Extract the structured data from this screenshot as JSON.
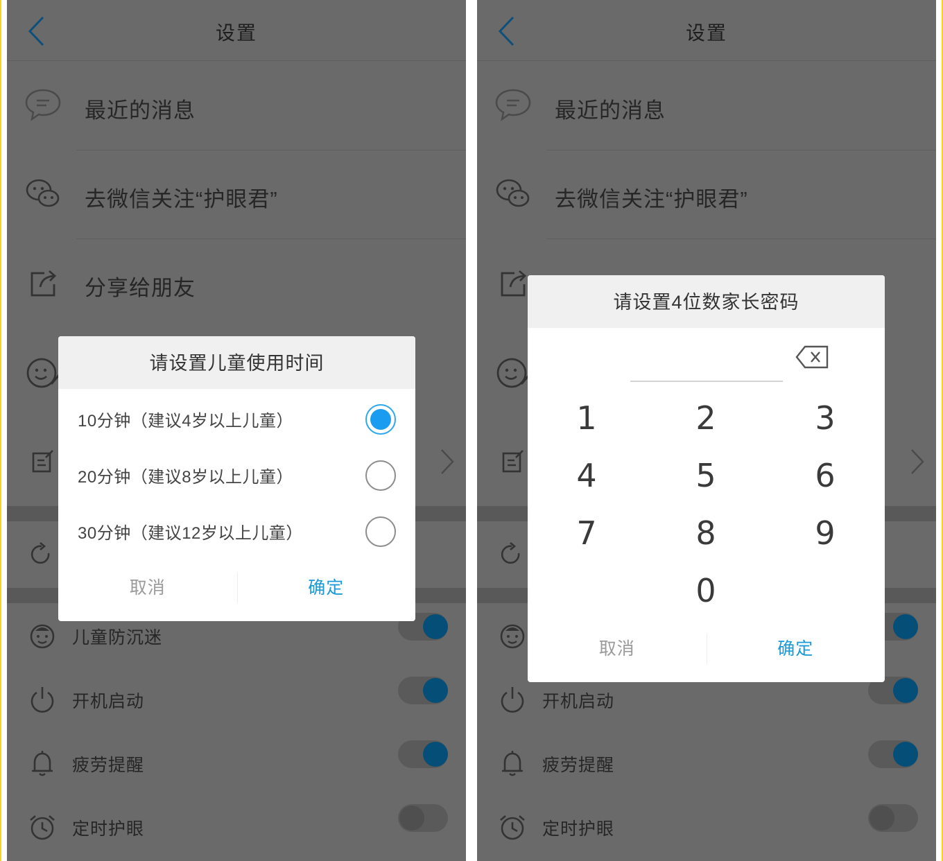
{
  "left": {
    "header": {
      "title": "设置"
    },
    "menu": [
      {
        "label": "最近的消息",
        "icon": "chat-bubble-icon"
      },
      {
        "label": "去微信关注“护眼君”",
        "icon": "wechat-icon"
      },
      {
        "label": "分享给朋友",
        "icon": "share-icon"
      }
    ],
    "toggles": [
      {
        "label": "儿童防沉迷",
        "icon": "child-face-icon",
        "on": true
      },
      {
        "label": "开机启动",
        "icon": "power-icon",
        "on": true
      },
      {
        "label": "疲劳提醒",
        "icon": "bell-icon",
        "on": true
      },
      {
        "label": "定时护眼",
        "icon": "alarm-clock-icon",
        "on": false
      }
    ],
    "dialog": {
      "title": "请设置儿童使用时间",
      "options": [
        {
          "text": "10分钟（建议4岁以上儿童）",
          "selected": true
        },
        {
          "text": "20分钟（建议8岁以上儿童）",
          "selected": false
        },
        {
          "text": "30分钟（建议12岁以上儿童）",
          "selected": false
        }
      ],
      "cancel": "取消",
      "ok": "确定"
    }
  },
  "right": {
    "header": {
      "title": "设置"
    },
    "menu": [
      {
        "label": "最近的消息",
        "icon": "chat-bubble-icon"
      },
      {
        "label": "去微信关注“护眼君”",
        "icon": "wechat-icon"
      }
    ],
    "toggles": [
      {
        "label": "开机启动",
        "icon": "power-icon",
        "on": true
      },
      {
        "label": "疲劳提醒",
        "icon": "bell-icon",
        "on": true
      },
      {
        "label": "定时护眼",
        "icon": "alarm-clock-icon",
        "on": false
      }
    ],
    "pin_dialog": {
      "title": "请设置4位数家长密码",
      "keys": [
        "1",
        "2",
        "3",
        "4",
        "5",
        "6",
        "7",
        "8",
        "9",
        "0"
      ],
      "cancel": "取消",
      "ok": "确定"
    }
  },
  "colors": {
    "overlay_bg": "#6a6a6a",
    "accent": "#1a9df0",
    "toggle_on": "#054e78",
    "frame": "#f6d420"
  }
}
